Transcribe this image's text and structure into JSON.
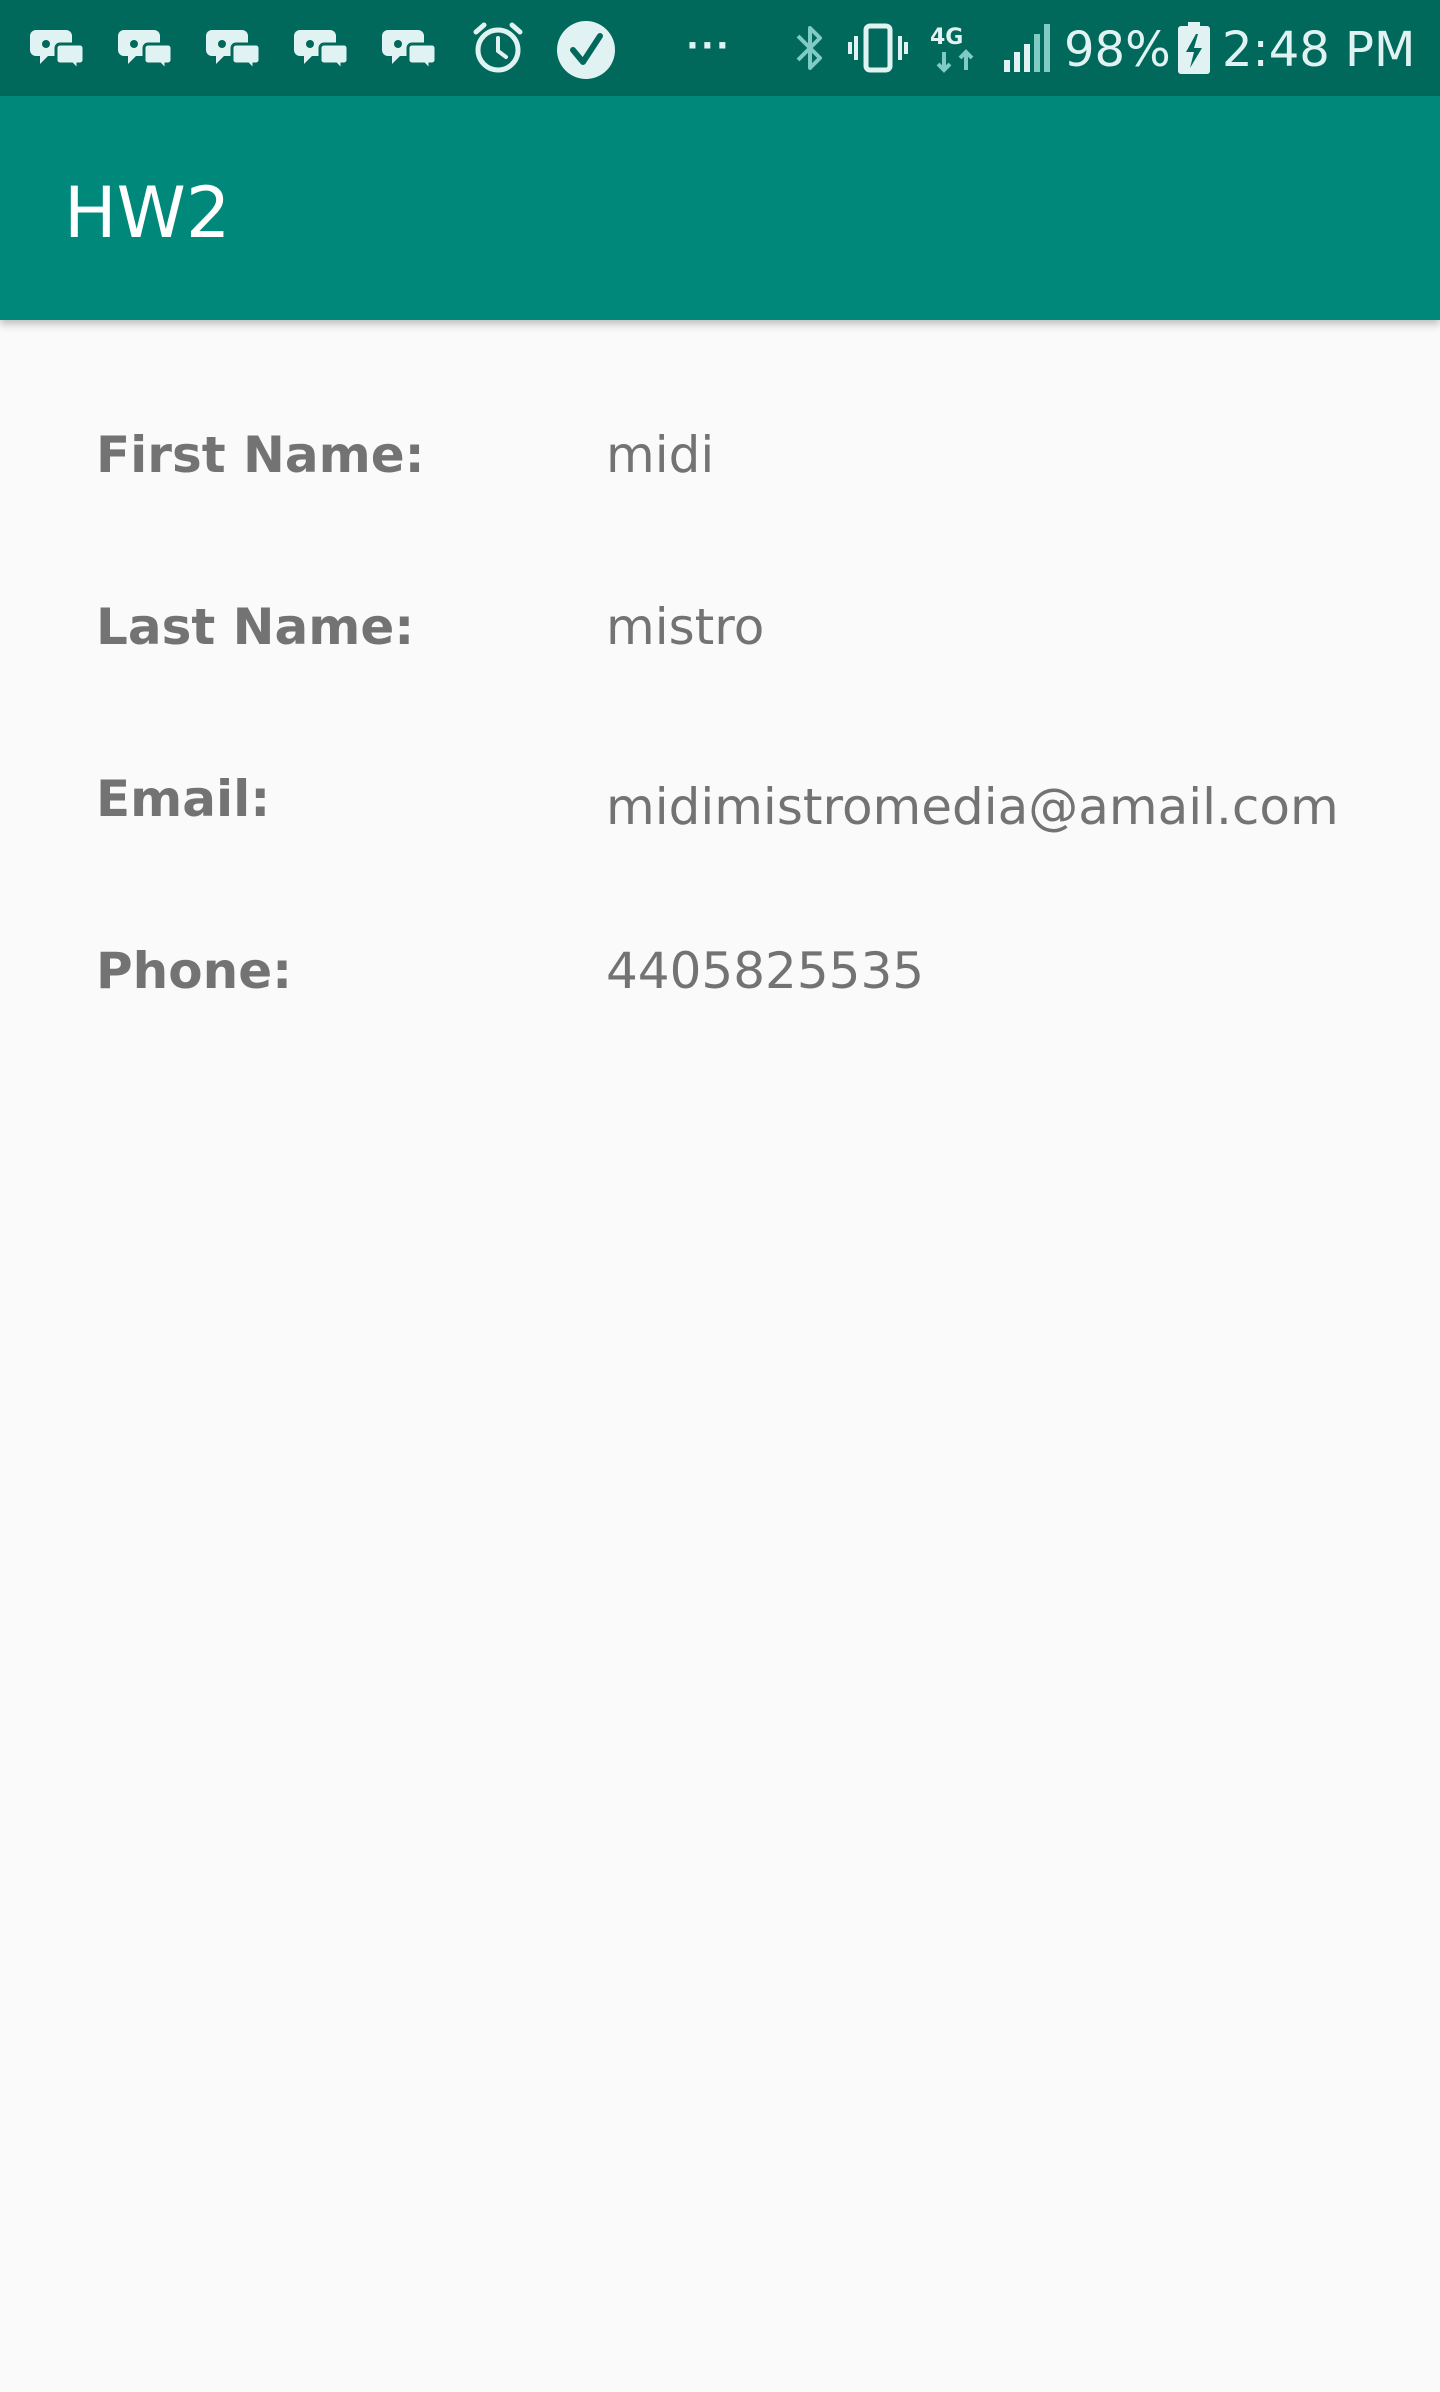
{
  "status_bar": {
    "notification_icons": [
      "chat-bubble-icon",
      "chat-bubble-icon",
      "chat-bubble-icon",
      "chat-bubble-icon",
      "chat-bubble-icon",
      "alarm-clock-icon",
      "check-circle-icon"
    ],
    "overflow_dots": "···",
    "system_icons": [
      "bluetooth-icon",
      "vibrate-icon",
      "4g-lte-icon",
      "signal-icon",
      "battery-charging-icon"
    ],
    "network_label": "4G",
    "battery_percent": "98%",
    "time": "2:48 PM"
  },
  "app_bar": {
    "title": "HW2"
  },
  "profile": {
    "fields": [
      {
        "label": "First Name:",
        "value": "midi"
      },
      {
        "label": "Last Name:",
        "value": "mistro"
      },
      {
        "label": "Email:",
        "value": "midimistromedia@amail.com"
      },
      {
        "label": "Phone:",
        "value": "4405825535"
      }
    ]
  },
  "colors": {
    "status_bar_bg": "#00695c",
    "app_bar_bg": "#00897b",
    "page_bg": "#fafafa",
    "text_gray": "#737373"
  }
}
